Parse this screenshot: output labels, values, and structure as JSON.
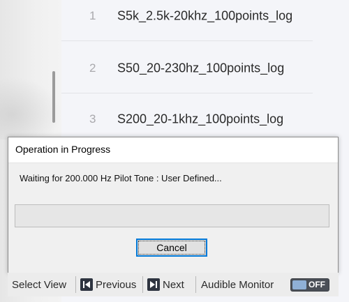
{
  "list": {
    "items": [
      {
        "number": "1",
        "label": "S5k_2.5k-20khz_100points_log"
      },
      {
        "number": "2",
        "label": "S50_20-230hz_100points_log"
      },
      {
        "number": "3",
        "label": "S200_20-1khz_100points_log"
      }
    ]
  },
  "dialog": {
    "title": "Operation in Progress",
    "message": "Waiting for 200.000 Hz Pilot Tone : User Defined...",
    "progress": 0,
    "cancel_label": "Cancel"
  },
  "toolbar": {
    "select_view_label": "Select View",
    "previous_label": "Previous",
    "next_label": "Next",
    "audible_monitor_label": "Audible Monitor",
    "audible_monitor_state": "OFF"
  }
}
